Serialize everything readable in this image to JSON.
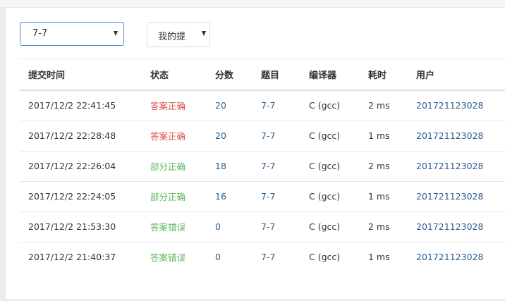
{
  "filters": {
    "problem_select": "7-7",
    "scope_select": "我的提"
  },
  "table": {
    "headers": [
      "提交时间",
      "状态",
      "分数",
      "题目",
      "编译器",
      "耗时",
      "用户"
    ],
    "rows": [
      {
        "time": "2017/12/2 22:41:45",
        "status": "答案正确",
        "status_color": "#d9534f",
        "score": "20",
        "problem": "7-7",
        "compiler": "C (gcc)",
        "cost": "2 ms",
        "user": "201721123028"
      },
      {
        "time": "2017/12/2 22:28:48",
        "status": "答案正确",
        "status_color": "#d9534f",
        "score": "20",
        "problem": "7-7",
        "compiler": "C (gcc)",
        "cost": "1 ms",
        "user": "201721123028"
      },
      {
        "time": "2017/12/2 22:26:04",
        "status": "部分正确",
        "status_color": "#5cb85c",
        "score": "18",
        "problem": "7-7",
        "compiler": "C (gcc)",
        "cost": "2 ms",
        "user": "201721123028"
      },
      {
        "time": "2017/12/2 22:24:05",
        "status": "部分正确",
        "status_color": "#5cb85c",
        "score": "16",
        "problem": "7-7",
        "compiler": "C (gcc)",
        "cost": "1 ms",
        "user": "201721123028"
      },
      {
        "time": "2017/12/2 21:53:30",
        "status": "答案错误",
        "status_color": "#5cb85c",
        "score": "0",
        "problem": "7-7",
        "compiler": "C (gcc)",
        "cost": "2 ms",
        "user": "201721123028"
      },
      {
        "time": "2017/12/2 21:40:37",
        "status": "答案错误",
        "status_color": "#5cb85c",
        "score": "0",
        "problem": "7-7",
        "compiler": "C (gcc)",
        "cost": "1 ms",
        "user": "201721123028"
      }
    ]
  },
  "colors": {
    "link": "#2a5d8f",
    "accepted": "#d9534f",
    "other": "#5cb85c",
    "focus_border": "#4a90d9"
  }
}
